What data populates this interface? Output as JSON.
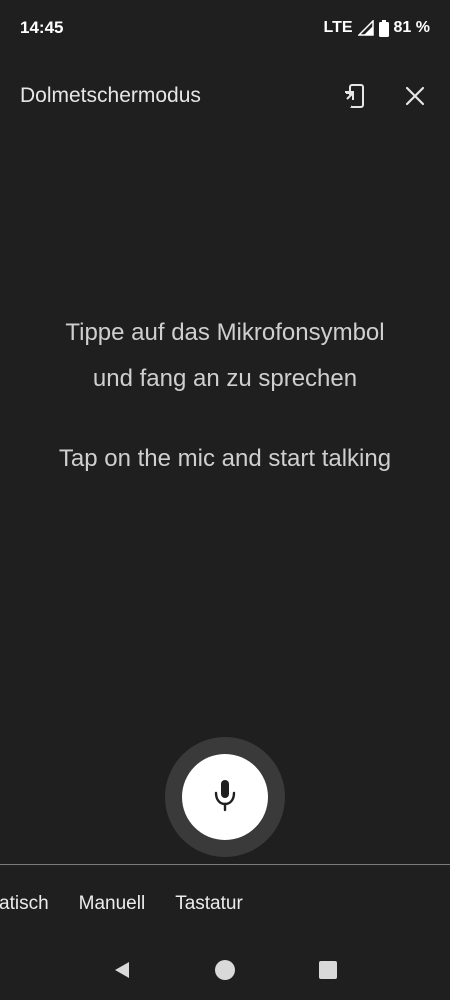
{
  "status_bar": {
    "time": "14:45",
    "network": "LTE",
    "battery": "81 %"
  },
  "app_bar": {
    "title": "Dolmetschermodus",
    "icons": [
      "cast-screen-icon",
      "close-icon"
    ]
  },
  "prompt": {
    "german_line1": "Tippe auf das Mikrofonsymbol",
    "german_line2": "und fang an zu sprechen",
    "english": "Tap on the mic and start talking"
  },
  "mic": {
    "icon": "microphone-icon"
  },
  "mode_tabs": [
    {
      "label": "atisch"
    },
    {
      "label": "Manuell"
    },
    {
      "label": "Tastatur"
    }
  ],
  "nav_bar": {
    "icons": [
      "back-icon",
      "home-icon",
      "recents-icon"
    ]
  },
  "colors": {
    "background": "#1f1f1f",
    "text": "#e3e3e3",
    "mic_button": "#ffffff",
    "mic_ring": "#3a3a3a"
  }
}
